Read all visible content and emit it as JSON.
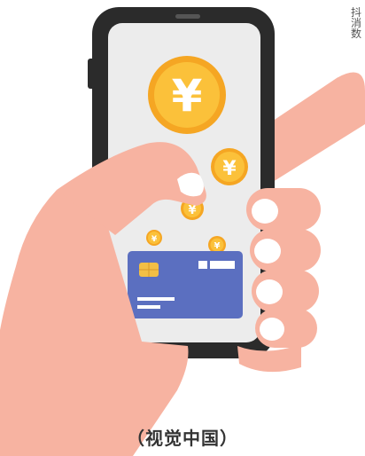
{
  "caption": "（视觉中国）",
  "edge_text": "抖\n消\n数",
  "coins": [
    {
      "name": "coin-large",
      "symbol": "¥"
    },
    {
      "name": "coin-medium",
      "symbol": "¥"
    },
    {
      "name": "coin-small-1",
      "symbol": "¥"
    },
    {
      "name": "coin-small-2",
      "symbol": "¥"
    },
    {
      "name": "coin-small-3",
      "symbol": "¥"
    }
  ],
  "colors": {
    "skin": "#f7b3a1",
    "phone_frame": "#2b2b2b",
    "screen": "#ececec",
    "coin_outer": "#f5a623",
    "coin_inner": "#fbc13a",
    "card": "#5b6fc0",
    "chip": "#f3bf45",
    "nail": "#ffffff"
  }
}
